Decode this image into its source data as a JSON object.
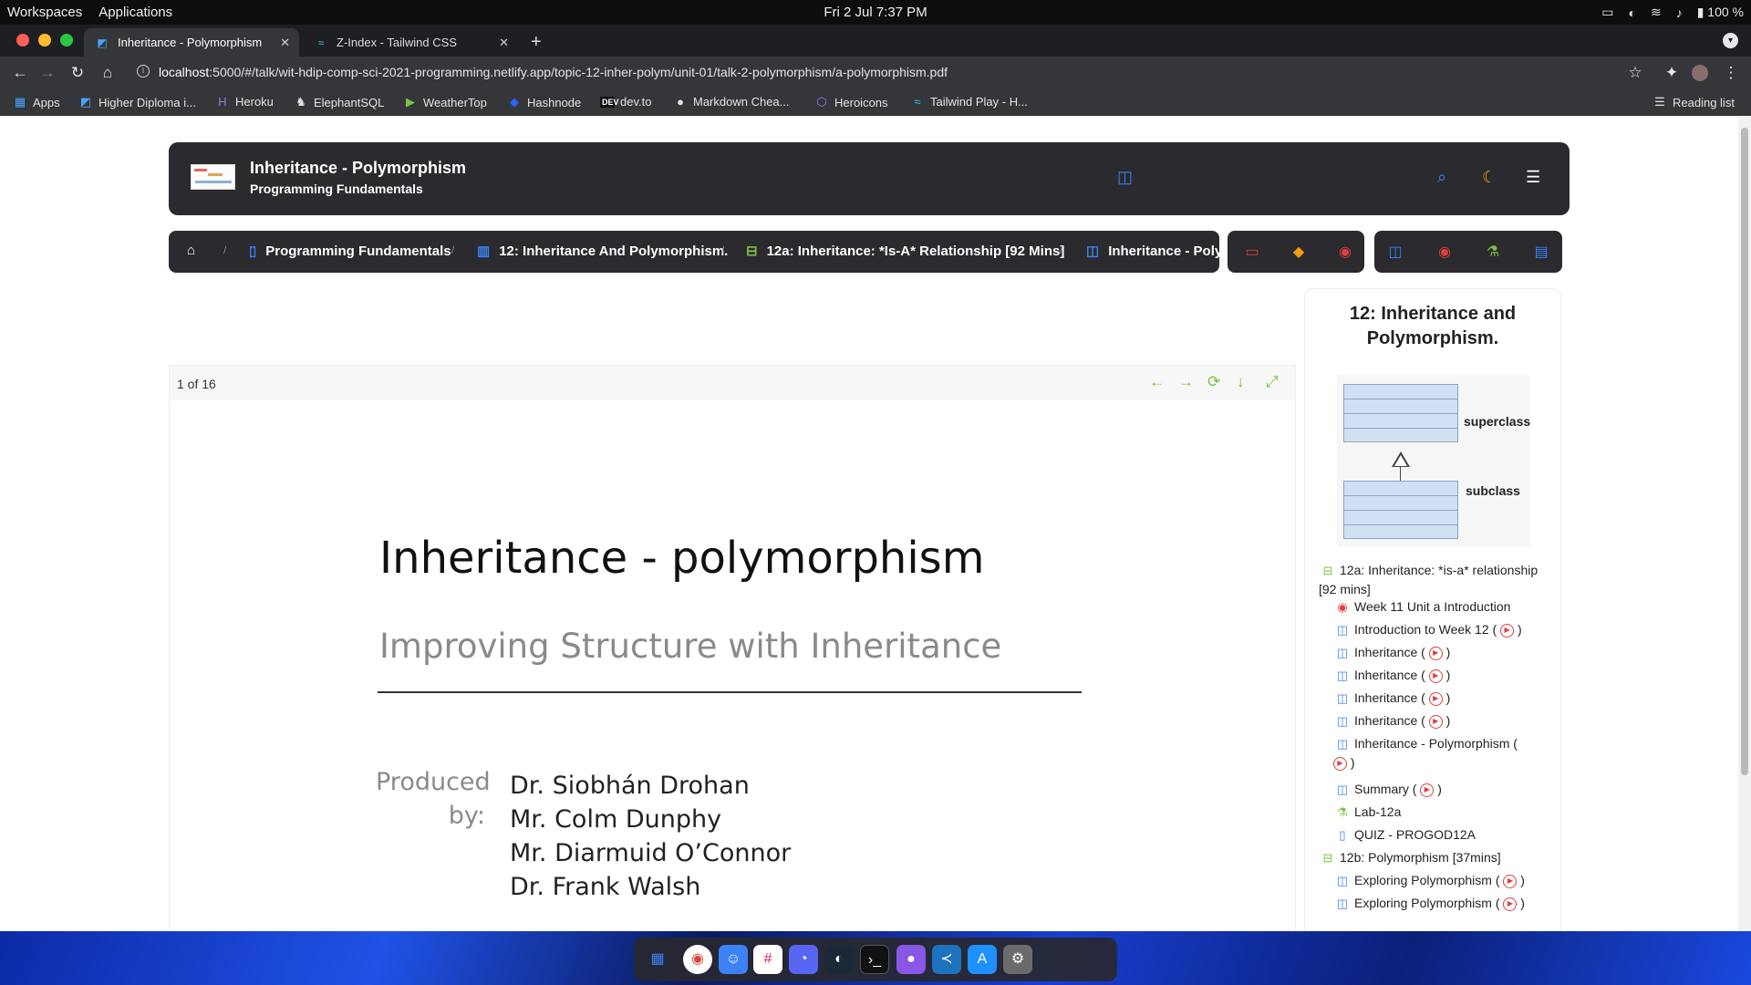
{
  "system_bar": {
    "workspaces": "Workspaces",
    "applications": "Applications",
    "clock": "Fri 2 Jul   7:37 PM",
    "battery": "100 %"
  },
  "browser": {
    "tabs": [
      {
        "title": "Inheritance - Polymorphism",
        "active": true
      },
      {
        "title": "Z-Index - Tailwind CSS",
        "active": false
      }
    ],
    "url_host": "localhost",
    "url_rest": ":5000/#/talk/wit-hdip-comp-sci-2021-programming.netlify.app/topic-12-inher-polym/unit-01/talk-2-polymorphism/a-polymorphism.pdf",
    "bookmarks": [
      {
        "label": "Apps",
        "icon": "apps-grid-icon"
      },
      {
        "label": "Higher Diploma i...",
        "icon": "tutors-icon"
      },
      {
        "label": "Heroku",
        "icon": "heroku-icon"
      },
      {
        "label": "ElephantSQL",
        "icon": "elephant-icon"
      },
      {
        "label": "WeatherTop",
        "icon": "play-icon"
      },
      {
        "label": "Hashnode",
        "icon": "hashnode-icon"
      },
      {
        "label": "dev.to",
        "icon": "devto-icon"
      },
      {
        "label": "Markdown Chea...",
        "icon": "github-icon"
      },
      {
        "label": "Heroicons",
        "icon": "heroicons-icon"
      },
      {
        "label": "Tailwind Play - H...",
        "icon": "tailwind-icon"
      }
    ],
    "reading_list": "Reading list"
  },
  "header": {
    "title": "Inheritance - Polymorphism",
    "subtitle": "Programming Fundamentals",
    "accent": "#3b82f6"
  },
  "breadcrumbs": [
    {
      "label": "Programming Fundamentals",
      "icon": "book-icon"
    },
    {
      "label": "12: Inheritance And Polymorphism.",
      "icon": "columns-icon"
    },
    {
      "label": "12a: Inheritance: *Is-A* Relationship [92 Mins]",
      "icon": "topic-icon"
    },
    {
      "label": "Inheritance - Polymorphism",
      "icon": "slides-icon"
    }
  ],
  "viewer": {
    "page_count": "1 of 16"
  },
  "slide": {
    "title": "Inheritance - polymorphism",
    "subtitle": "Improving Structure with Inheritance",
    "produced_by": [
      "Produced",
      "by:"
    ],
    "authors": [
      "Dr. Siobhán Drohan",
      "Mr. Colm Dunphy",
      "Mr. Diarmuid O’Connor",
      "Dr. Frank Walsh"
    ]
  },
  "sidebar": {
    "title": "12: Inheritance and Polymorphism.",
    "uml": {
      "superclass": "superclass",
      "subclass": "subclass"
    },
    "tree": [
      {
        "label": "12a: Inheritance: *is-a* relationship [92 mins]",
        "type": "topic",
        "video": false
      },
      {
        "label": "Week 11 Unit a Introduction",
        "type": "video",
        "video": false
      },
      {
        "label": "Introduction to Week 12",
        "type": "slides",
        "video": true
      },
      {
        "label": "Inheritance",
        "type": "slides",
        "video": true
      },
      {
        "label": "Inheritance",
        "type": "slides",
        "video": true
      },
      {
        "label": "Inheritance",
        "type": "slides",
        "video": true
      },
      {
        "label": "Inheritance",
        "type": "slides",
        "video": true
      },
      {
        "label": "Inheritance - Polymorphism",
        "type": "slides",
        "video": true
      },
      {
        "label": "Summary",
        "type": "slides",
        "video": true
      },
      {
        "label": "Lab-12a",
        "type": "lab",
        "video": false
      },
      {
        "label": "QUIZ - PROGOD12A",
        "type": "quiz",
        "video": false
      },
      {
        "label": "12b: Polymorphism [37mins]",
        "type": "topic",
        "video": false
      },
      {
        "label": "Exploring Polymorphism",
        "type": "slides",
        "video": true
      },
      {
        "label": "Exploring Polymorphism",
        "type": "slides",
        "video": true
      }
    ]
  },
  "colors": {
    "video_red": "#e03d3d",
    "lab_green": "#7cc243",
    "slides_blue": "#3b82f6"
  }
}
